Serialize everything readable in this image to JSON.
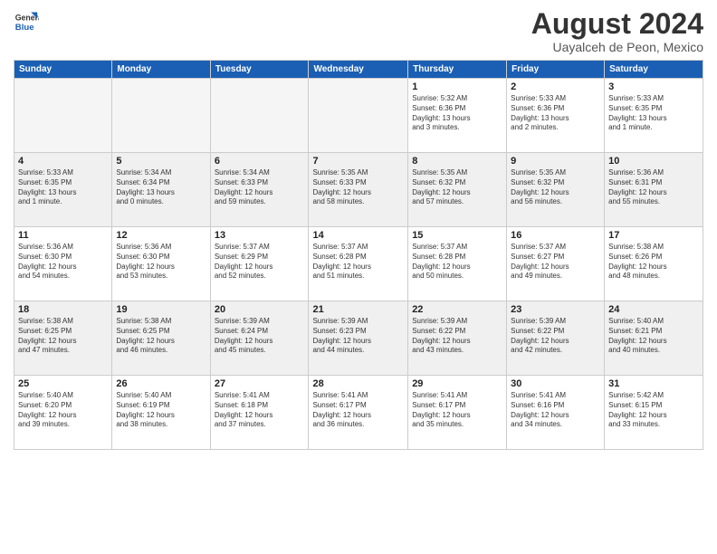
{
  "header": {
    "logo_line1": "General",
    "logo_line2": "Blue",
    "month_title": "August 2024",
    "subtitle": "Uayalceh de Peon, Mexico"
  },
  "days_of_week": [
    "Sunday",
    "Monday",
    "Tuesday",
    "Wednesday",
    "Thursday",
    "Friday",
    "Saturday"
  ],
  "weeks": [
    [
      {
        "day": "",
        "info": ""
      },
      {
        "day": "",
        "info": ""
      },
      {
        "day": "",
        "info": ""
      },
      {
        "day": "",
        "info": ""
      },
      {
        "day": "1",
        "info": "Sunrise: 5:32 AM\nSunset: 6:36 PM\nDaylight: 13 hours\nand 3 minutes."
      },
      {
        "day": "2",
        "info": "Sunrise: 5:33 AM\nSunset: 6:36 PM\nDaylight: 13 hours\nand 2 minutes."
      },
      {
        "day": "3",
        "info": "Sunrise: 5:33 AM\nSunset: 6:35 PM\nDaylight: 13 hours\nand 1 minute."
      }
    ],
    [
      {
        "day": "4",
        "info": "Sunrise: 5:33 AM\nSunset: 6:35 PM\nDaylight: 13 hours\nand 1 minute."
      },
      {
        "day": "5",
        "info": "Sunrise: 5:34 AM\nSunset: 6:34 PM\nDaylight: 13 hours\nand 0 minutes."
      },
      {
        "day": "6",
        "info": "Sunrise: 5:34 AM\nSunset: 6:33 PM\nDaylight: 12 hours\nand 59 minutes."
      },
      {
        "day": "7",
        "info": "Sunrise: 5:35 AM\nSunset: 6:33 PM\nDaylight: 12 hours\nand 58 minutes."
      },
      {
        "day": "8",
        "info": "Sunrise: 5:35 AM\nSunset: 6:32 PM\nDaylight: 12 hours\nand 57 minutes."
      },
      {
        "day": "9",
        "info": "Sunrise: 5:35 AM\nSunset: 6:32 PM\nDaylight: 12 hours\nand 56 minutes."
      },
      {
        "day": "10",
        "info": "Sunrise: 5:36 AM\nSunset: 6:31 PM\nDaylight: 12 hours\nand 55 minutes."
      }
    ],
    [
      {
        "day": "11",
        "info": "Sunrise: 5:36 AM\nSunset: 6:30 PM\nDaylight: 12 hours\nand 54 minutes."
      },
      {
        "day": "12",
        "info": "Sunrise: 5:36 AM\nSunset: 6:30 PM\nDaylight: 12 hours\nand 53 minutes."
      },
      {
        "day": "13",
        "info": "Sunrise: 5:37 AM\nSunset: 6:29 PM\nDaylight: 12 hours\nand 52 minutes."
      },
      {
        "day": "14",
        "info": "Sunrise: 5:37 AM\nSunset: 6:28 PM\nDaylight: 12 hours\nand 51 minutes."
      },
      {
        "day": "15",
        "info": "Sunrise: 5:37 AM\nSunset: 6:28 PM\nDaylight: 12 hours\nand 50 minutes."
      },
      {
        "day": "16",
        "info": "Sunrise: 5:37 AM\nSunset: 6:27 PM\nDaylight: 12 hours\nand 49 minutes."
      },
      {
        "day": "17",
        "info": "Sunrise: 5:38 AM\nSunset: 6:26 PM\nDaylight: 12 hours\nand 48 minutes."
      }
    ],
    [
      {
        "day": "18",
        "info": "Sunrise: 5:38 AM\nSunset: 6:25 PM\nDaylight: 12 hours\nand 47 minutes."
      },
      {
        "day": "19",
        "info": "Sunrise: 5:38 AM\nSunset: 6:25 PM\nDaylight: 12 hours\nand 46 minutes."
      },
      {
        "day": "20",
        "info": "Sunrise: 5:39 AM\nSunset: 6:24 PM\nDaylight: 12 hours\nand 45 minutes."
      },
      {
        "day": "21",
        "info": "Sunrise: 5:39 AM\nSunset: 6:23 PM\nDaylight: 12 hours\nand 44 minutes."
      },
      {
        "day": "22",
        "info": "Sunrise: 5:39 AM\nSunset: 6:22 PM\nDaylight: 12 hours\nand 43 minutes."
      },
      {
        "day": "23",
        "info": "Sunrise: 5:39 AM\nSunset: 6:22 PM\nDaylight: 12 hours\nand 42 minutes."
      },
      {
        "day": "24",
        "info": "Sunrise: 5:40 AM\nSunset: 6:21 PM\nDaylight: 12 hours\nand 40 minutes."
      }
    ],
    [
      {
        "day": "25",
        "info": "Sunrise: 5:40 AM\nSunset: 6:20 PM\nDaylight: 12 hours\nand 39 minutes."
      },
      {
        "day": "26",
        "info": "Sunrise: 5:40 AM\nSunset: 6:19 PM\nDaylight: 12 hours\nand 38 minutes."
      },
      {
        "day": "27",
        "info": "Sunrise: 5:41 AM\nSunset: 6:18 PM\nDaylight: 12 hours\nand 37 minutes."
      },
      {
        "day": "28",
        "info": "Sunrise: 5:41 AM\nSunset: 6:17 PM\nDaylight: 12 hours\nand 36 minutes."
      },
      {
        "day": "29",
        "info": "Sunrise: 5:41 AM\nSunset: 6:17 PM\nDaylight: 12 hours\nand 35 minutes."
      },
      {
        "day": "30",
        "info": "Sunrise: 5:41 AM\nSunset: 6:16 PM\nDaylight: 12 hours\nand 34 minutes."
      },
      {
        "day": "31",
        "info": "Sunrise: 5:42 AM\nSunset: 6:15 PM\nDaylight: 12 hours\nand 33 minutes."
      }
    ]
  ]
}
